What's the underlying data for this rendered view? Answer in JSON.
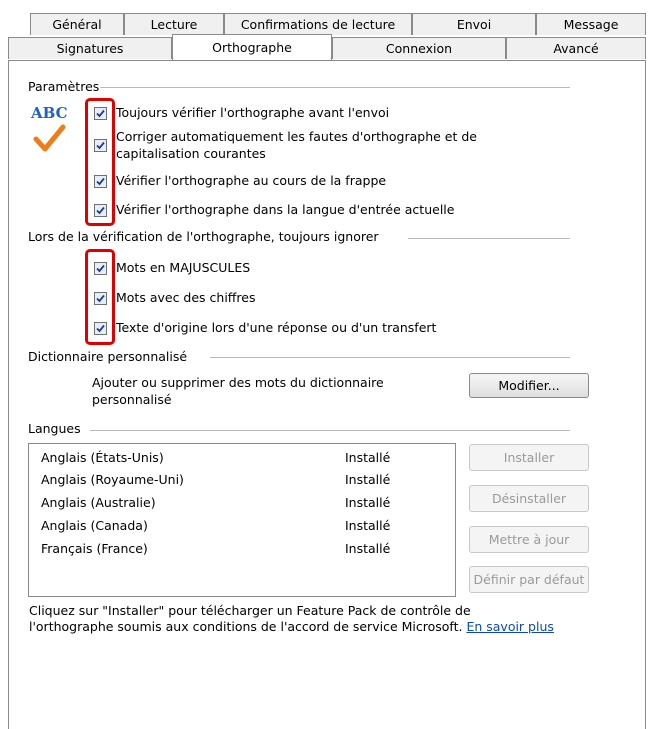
{
  "tabs_row1": [
    {
      "label": "Général"
    },
    {
      "label": "Lecture"
    },
    {
      "label": "Confirmations de lecture"
    },
    {
      "label": "Envoi"
    },
    {
      "label": "Message"
    }
  ],
  "tabs_row2": [
    {
      "label": "Signatures"
    },
    {
      "label": "Orthographe",
      "active": true
    },
    {
      "label": "Connexion"
    },
    {
      "label": "Avancé"
    }
  ],
  "settings": {
    "title": "Paramètres",
    "logo_text": "ABC",
    "options": [
      {
        "label": "Toujours vérifier l'orthographe avant l'envoi",
        "checked": true
      },
      {
        "label": "Corriger automatiquement les fautes d'orthographe et de",
        "label2": "capitalisation courantes",
        "checked": true
      },
      {
        "label": "Vérifier l'orthographe au cours de la frappe",
        "checked": true
      },
      {
        "label": "Vérifier l'orthographe dans la langue d'entrée actuelle",
        "checked": true
      }
    ]
  },
  "ignore": {
    "title": "Lors de la vérification de l'orthographe, toujours ignorer",
    "options": [
      {
        "label": "Mots en MAJUSCULES",
        "checked": true
      },
      {
        "label": "Mots avec des chiffres",
        "checked": true
      },
      {
        "label": "Texte d'origine lors d'une réponse ou d'un transfert",
        "checked": true
      }
    ]
  },
  "dictionary": {
    "title": "Dictionnaire personnalisé",
    "description_line1": "Ajouter ou supprimer des mots du dictionnaire",
    "description_line2": "personnalisé",
    "modify_button": "Modifier..."
  },
  "languages": {
    "title": "Langues",
    "items": [
      {
        "name": "Anglais (États-Unis)",
        "status": "Installé"
      },
      {
        "name": "Anglais (Royaume-Uni)",
        "status": "Installé"
      },
      {
        "name": "Anglais (Australie)",
        "status": "Installé"
      },
      {
        "name": "Anglais (Canada)",
        "status": "Installé"
      },
      {
        "name": "Français (France)",
        "status": "Installé"
      }
    ],
    "buttons": {
      "install": "Installer",
      "uninstall": "Désinstaller",
      "update": "Mettre à jour",
      "set_default": "Définir par défaut"
    }
  },
  "note": {
    "line1": "Cliquez sur \"Installer\" pour télécharger un Feature Pack de contrôle de",
    "line2": "l'orthographe soumis aux conditions de l'accord de service Microsoft.",
    "link": "En savoir plus"
  },
  "colors": {
    "highlight": "#e00000",
    "logo_blue": "#1b5fc9",
    "checkmark_orange": "#f07c18",
    "link": "#0a47c8"
  }
}
